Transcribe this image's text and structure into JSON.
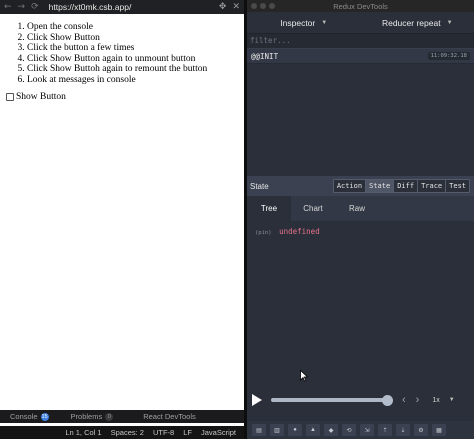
{
  "browser": {
    "url": "https://xt0mk.csb.app/",
    "nav_back": "←",
    "nav_forward": "→",
    "nav_reload": "⟳"
  },
  "page": {
    "steps": [
      "Open the console",
      "Click Show Button",
      "Click the button a few times",
      "Click Show Button again to unmount button",
      "Click Show Buttoh again to remount the button",
      "Look at messages in console"
    ],
    "checkbox_label": "Show Button",
    "checkbox_checked": false
  },
  "bottom_tabs": {
    "console": "Console",
    "console_count": "15",
    "problems": "Problems",
    "problems_count": "0",
    "react_devtools": "React DevTools"
  },
  "status_bar": {
    "position": "Ln 1, Col 1",
    "spaces": "Spaces: 2",
    "encoding": "UTF-8",
    "eol": "LF",
    "language": "JavaScript"
  },
  "devtools": {
    "title": "Redux DevTools",
    "monitor": "Inspector",
    "reducer": "Reducer repeat",
    "filter_placeholder": "filter...",
    "actions": [
      {
        "name": "@@INIT",
        "time": "11:09:32.18"
      }
    ],
    "state_title": "State",
    "state_tabs": [
      "Action",
      "State",
      "Diff",
      "Trace",
      "Test"
    ],
    "active_state_tab": "State",
    "view_tabs": [
      "Tree",
      "Chart",
      "Raw"
    ],
    "active_view_tab": "Tree",
    "state_root": "(pin)",
    "state_value": "undefined",
    "speed": "1x",
    "slider_progress": 1.0
  },
  "colors": {
    "accent_blue": "#3b7ee0",
    "devtools_bg": "#2a2f3a",
    "undefined_value": "#e8728a"
  },
  "icons": [
    "back-icon",
    "forward-icon",
    "reload-icon",
    "split-icon",
    "close-icon",
    "play-icon",
    "step-back-icon",
    "step-forward-icon"
  ]
}
